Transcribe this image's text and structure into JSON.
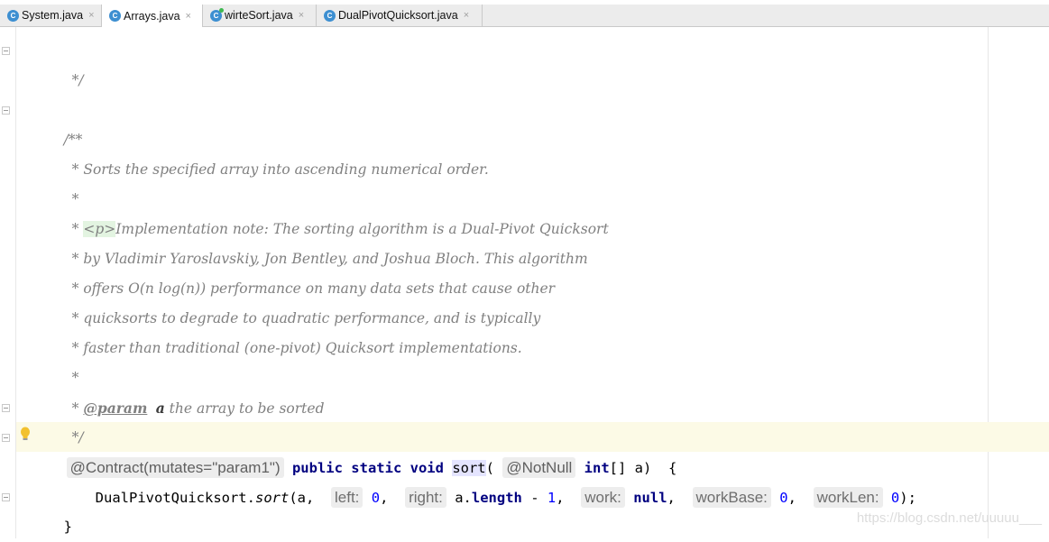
{
  "tabs": [
    {
      "label": "System.java",
      "icon": "java-class-icon",
      "active": false
    },
    {
      "label": "Arrays.java",
      "icon": "java-class-icon",
      "active": true
    },
    {
      "label": "wirteSort.java",
      "icon": "java-class-modified-icon",
      "active": false
    },
    {
      "label": "DualPivotQuicksort.java",
      "icon": "java-class-icon",
      "active": false
    }
  ],
  "tab_icon_letter": "C",
  "close_glyph": "×",
  "code": {
    "l1": "*/",
    "l3": "/**",
    "l4": "* Sorts the specified array into ascending numerical order.",
    "l5": "*",
    "l6_star": "* ",
    "l6_tag": "<p>",
    "l6_rest": "Implementation note: The sorting algorithm is a Dual-Pivot Quicksort",
    "l7": "* by Vladimir Yaroslavskiy, Jon Bentley, and Joshua Bloch. This algorithm",
    "l8": "* offers O(n log(n)) performance on many data sets that cause other",
    "l9": "* quicksorts to degrade to quadratic performance, and is typically",
    "l10": "* faster than traditional (one-pivot) Quicksort implementations.",
    "l11": "*",
    "l12_star": "* ",
    "l12_tag": "@param",
    "l12_name": "a",
    "l12_rest": " the array to be sorted",
    "l13": "*/",
    "l14": {
      "contract": "@Contract(mutates=\"param1\")",
      "public": "public",
      "static": "static",
      "void": "void",
      "method": "sort",
      "open": "(",
      "notnull": "@NotNull",
      "int": "int",
      "rest": "[] a)  {"
    },
    "l15": {
      "call": "DualPivotQuicksort.",
      "method": "sort",
      "open": "(a,  ",
      "hint_left": "left:",
      "zero1": "0",
      "comma1": ",  ",
      "hint_right": "right:",
      "a_dot": "a.",
      "length": "length",
      "minus": " - ",
      "one": "1",
      "comma2": ",  ",
      "hint_work": "work:",
      "null": "null",
      "comma3": ",  ",
      "hint_workbase": "workBase:",
      "zero2": "0",
      "comma4": ",  ",
      "hint_worklen": "workLen:",
      "zero3": "0",
      "close": ");"
    },
    "l16": "}"
  },
  "watermark": "https://blog.csdn.net/uuuuu___"
}
